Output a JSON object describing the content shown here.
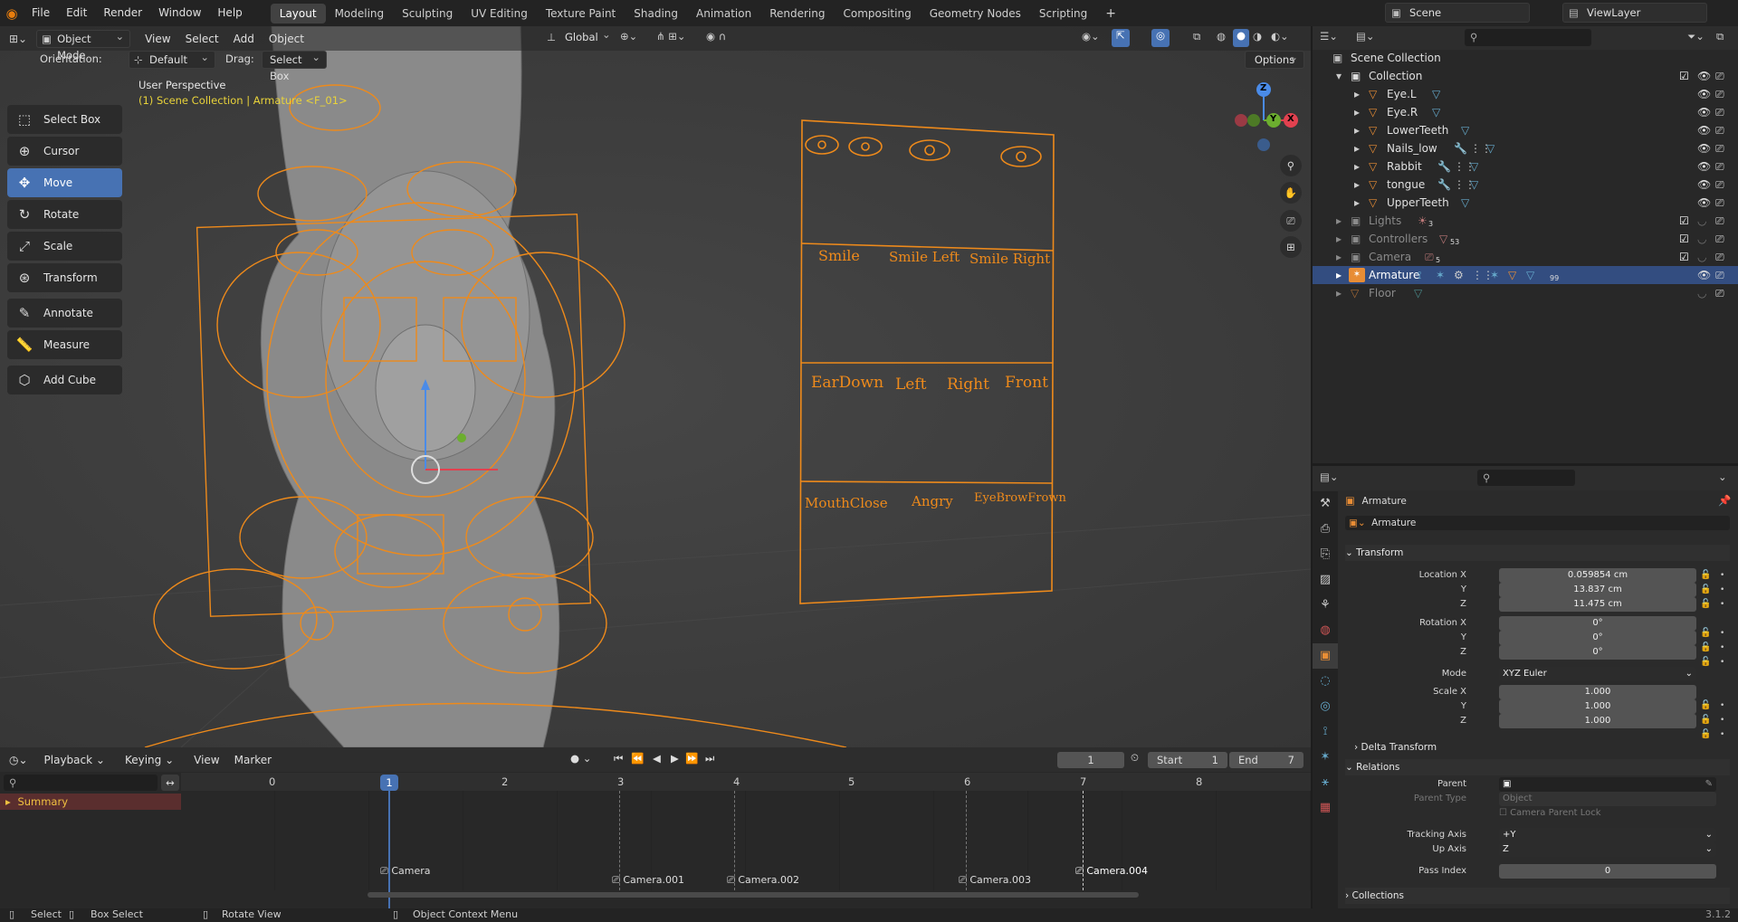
{
  "topbar": {
    "menus": [
      "File",
      "Edit",
      "Render",
      "Window",
      "Help"
    ],
    "workspaces": [
      "Layout",
      "Modeling",
      "Sculpting",
      "UV Editing",
      "Texture Paint",
      "Shading",
      "Animation",
      "Rendering",
      "Compositing",
      "Geometry Nodes",
      "Scripting"
    ],
    "active_workspace": "Layout",
    "add_tab": "+",
    "scene": "Scene",
    "view_layer": "ViewLayer"
  },
  "viewport": {
    "mode": "Object Mode",
    "menus": [
      "View",
      "Select",
      "Add",
      "Object"
    ],
    "orientation_label": "Orientation:",
    "orientation_value": "Default",
    "drag_label": "Drag:",
    "drag_value": "Select Box",
    "transform_orientation": "Global",
    "options": "Options",
    "perspective_label": "User Perspective",
    "context_label": "(1) Scene Collection | Armature <F_01>",
    "gizmo": {
      "x": "X",
      "y": "Y",
      "z": "Z"
    },
    "tools": [
      "Select Box",
      "Cursor",
      "Move",
      "Rotate",
      "Scale",
      "Transform",
      "Annotate",
      "Measure",
      "Add Cube"
    ],
    "active_tool": "Move",
    "face_board": {
      "row1": [
        "Smile",
        "Smile Left",
        "Smile Right"
      ],
      "row2": [
        "EarDown",
        "Left",
        "Right",
        "Front"
      ],
      "row3": [
        "MouthClose",
        "Angry",
        "EyeBrowFrown"
      ]
    }
  },
  "timeline": {
    "menus": [
      "Playback",
      "Keying",
      "View",
      "Marker"
    ],
    "current_frame": "1",
    "start_label": "Start",
    "start": "1",
    "end_label": "End",
    "end": "7",
    "ticks": [
      "0",
      "1",
      "2",
      "3",
      "4",
      "5",
      "6",
      "7",
      "8"
    ],
    "summary": "Summary",
    "markers": [
      "Camera",
      "Camera.001",
      "Camera.002",
      "Camera.003",
      "Camera.004"
    ]
  },
  "outliner": {
    "root": "Scene Collection",
    "collection": "Collection",
    "children": [
      "Eye.L",
      "Eye.R",
      "LowerTeeth",
      "Nails_low",
      "Rabbit",
      "tongue",
      "UpperTeeth"
    ],
    "top_items": [
      {
        "name": "Lights",
        "count": "3"
      },
      {
        "name": "Controllers",
        "count": "53"
      },
      {
        "name": "Camera",
        "count": "5"
      },
      {
        "name": "Armature",
        "count": "99"
      },
      {
        "name": "Floor",
        "count": ""
      }
    ]
  },
  "properties": {
    "object_name": "Armature",
    "data_name": "Armature",
    "transform_header": "Transform",
    "location": {
      "x": "0.059854 cm",
      "y": "13.837 cm",
      "z": "11.475 cm"
    },
    "rotation": {
      "x": "0°",
      "y": "0°",
      "z": "0°"
    },
    "labels": {
      "location_x": "Location X",
      "rotation_x": "Rotation X",
      "scale_x": "Scale X",
      "y": "Y",
      "z": "Z",
      "mode": "Mode"
    },
    "mode": "XYZ Euler",
    "scale": {
      "x": "1.000",
      "y": "1.000",
      "z": "1.000"
    },
    "delta_transform": "Delta Transform",
    "relations_header": "Relations",
    "parent_label": "Parent",
    "parent_type_label": "Parent Type",
    "parent_type_value": "Object",
    "camera_parent_lock": "Camera Parent Lock",
    "tracking_axis_label": "Tracking Axis",
    "tracking_axis": "+Y",
    "up_axis_label": "Up Axis",
    "up_axis": "Z",
    "pass_index_label": "Pass Index",
    "pass_index": "0",
    "collections": "Collections"
  },
  "status": {
    "select": "Select",
    "box_select": "Box Select",
    "rotate_view": "Rotate View",
    "context_menu": "Object Context Menu",
    "version": "3.1.2"
  }
}
